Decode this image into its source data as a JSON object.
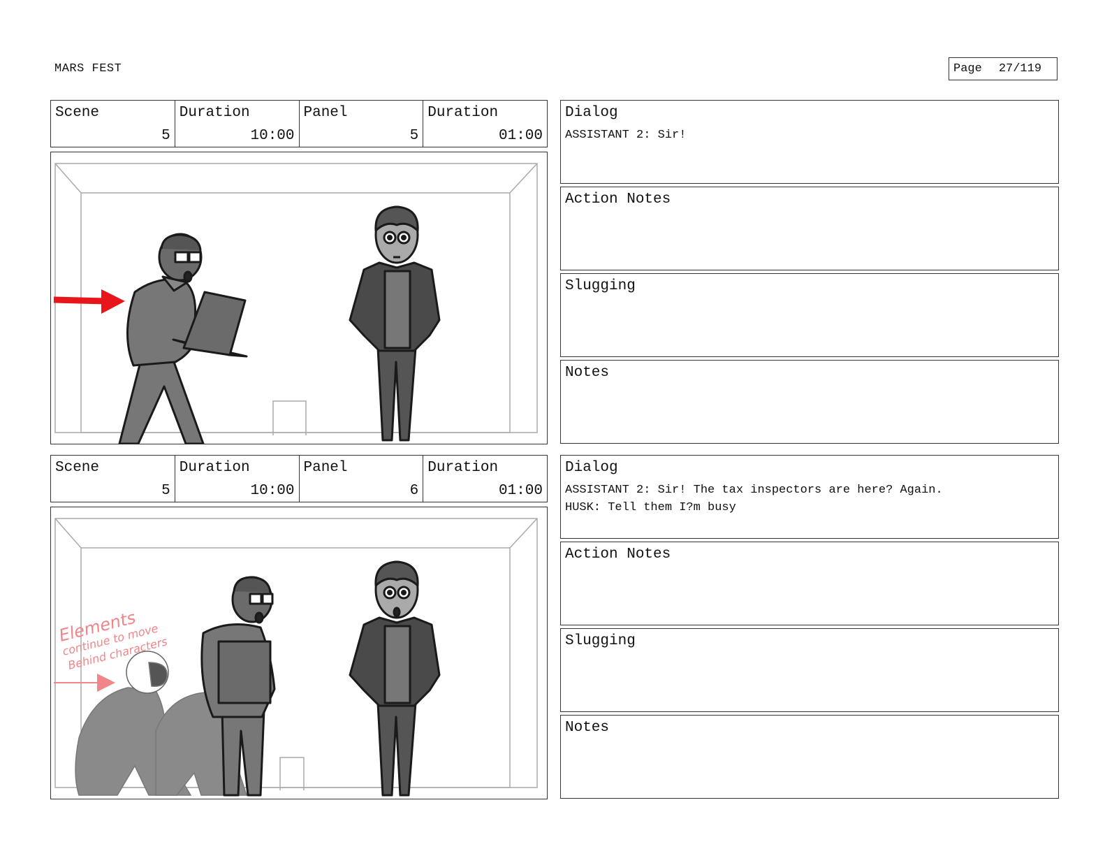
{
  "header": {
    "project_title": "MARS FEST",
    "page_label": "Page",
    "page_number": "27/119"
  },
  "panels": [
    {
      "scene_label": "Scene",
      "scene_value": "5",
      "scene_duration_label": "Duration",
      "scene_duration_value": "10:00",
      "panel_label": "Panel",
      "panel_value": "5",
      "panel_duration_label": "Duration",
      "panel_duration_value": "01:00",
      "dialog_label": "Dialog",
      "dialog_text": "ASSISTANT 2: Sir!",
      "action_notes_label": "Action Notes",
      "action_notes_text": "",
      "slugging_label": "Slugging",
      "slugging_text": "",
      "notes_label": "Notes",
      "notes_text": ""
    },
    {
      "scene_label": "Scene",
      "scene_value": "5",
      "scene_duration_label": "Duration",
      "scene_duration_value": "10:00",
      "panel_label": "Panel",
      "panel_value": "6",
      "panel_duration_label": "Duration",
      "panel_duration_value": "01:00",
      "dialog_label": "Dialog",
      "dialog_text": "ASSISTANT 2: Sir! The tax inspectors are here? Again.\nHUSK: Tell them I?m busy",
      "action_notes_label": "Action Notes",
      "action_notes_text": "",
      "slugging_label": "Slugging",
      "slugging_text": "",
      "notes_label": "Notes",
      "notes_text": "",
      "sketch_annotation_lines": [
        "Elements",
        "continue to move",
        "Behind characters"
      ]
    }
  ],
  "colors": {
    "arrow_red": "#e8161b",
    "annotation_pink": "#f0858a",
    "figure_gray": "#6b6b6b",
    "figure_dark": "#4a4a4a",
    "room_line": "#aaaaaa"
  }
}
